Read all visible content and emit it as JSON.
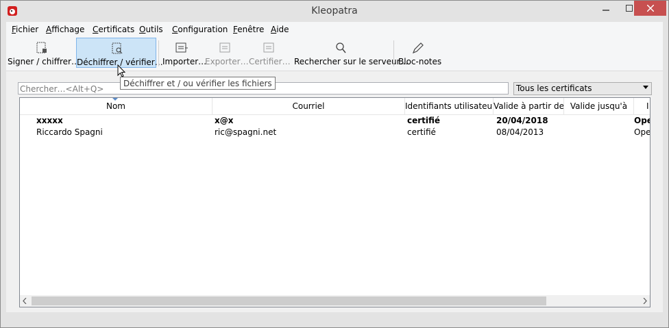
{
  "window": {
    "title": "Kleopatra",
    "minimize_glyph": "—",
    "maximize_glyph": "☐",
    "close_glyph": "✕"
  },
  "menu": {
    "items": [
      {
        "mnemonic": "F",
        "rest": "ichier"
      },
      {
        "mnemonic": "A",
        "rest": "ffichage"
      },
      {
        "mnemonic": "C",
        "rest": "ertificats"
      },
      {
        "mnemonic": "O",
        "rest": "utils"
      },
      {
        "mnemonic": "C",
        "rest": "onfiguration"
      },
      {
        "mnemonic": "F",
        "rest": "enêtre"
      },
      {
        "mnemonic": "A",
        "rest": "ide"
      }
    ]
  },
  "toolbar": {
    "sign_encrypt": "Signer / chiffrer…",
    "decrypt_verify": "Déchiffrer / vérifier…",
    "import": "Importer…",
    "export": "Exporter…",
    "certify": "Certifier…",
    "search_server": "Rechercher sur le serveur…",
    "notepad": "Bloc-notes"
  },
  "tooltip": "Déchiffrer et / ou vérifier les fichiers",
  "search": {
    "placeholder": "Chercher…<Alt+Q>"
  },
  "filter": {
    "selected": "Tous les certificats"
  },
  "table": {
    "columns": [
      "Nom",
      "Courriel",
      "Identifiants utilisateur",
      "Valide à partir de",
      "Valide jusqu'à",
      "I"
    ],
    "rows": [
      {
        "name": "xxxxx",
        "email": "x@x",
        "ids": "certifié",
        "valid_from": "20/04/2018",
        "valid_until": "",
        "protocol": "Ope"
      },
      {
        "name": "Riccardo Spagni",
        "email": "ric@spagni.net",
        "ids": "certifié",
        "valid_from": "08/04/2013",
        "valid_until": "",
        "protocol": "Ope"
      }
    ]
  },
  "colors": {
    "close_button": "#c75050",
    "active_tool": "#cce4f7"
  }
}
